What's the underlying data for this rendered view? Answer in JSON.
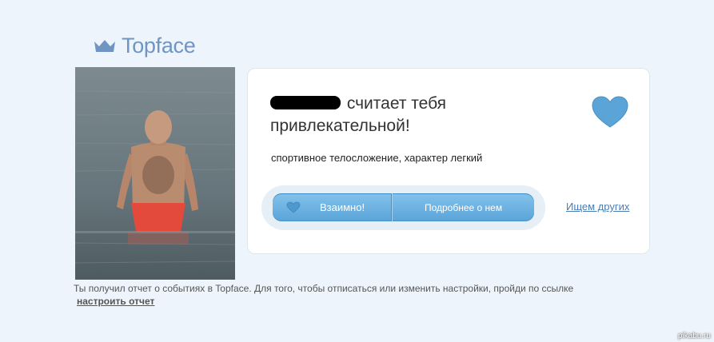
{
  "brand": {
    "name": "Topface",
    "icon": "crown-icon",
    "color": "#6f95c2"
  },
  "notification": {
    "headline": "считает тебя привлекательной!",
    "description": "спортивное телосложение, характер легкий",
    "heart_icon": "heart-icon",
    "accent_color": "#5aa4d8"
  },
  "actions": {
    "mutual_label": "Взаимно!",
    "more_label": "Подробнее о нем",
    "search_others_label": "Ищем других"
  },
  "footer": {
    "text": "Ты получил отчет о событиях в Topface. Для того, чтобы отписаться или изменить настройки, пройди по ссылке",
    "settings_link": "настроить отчет"
  },
  "watermark": "pikabu.ru"
}
